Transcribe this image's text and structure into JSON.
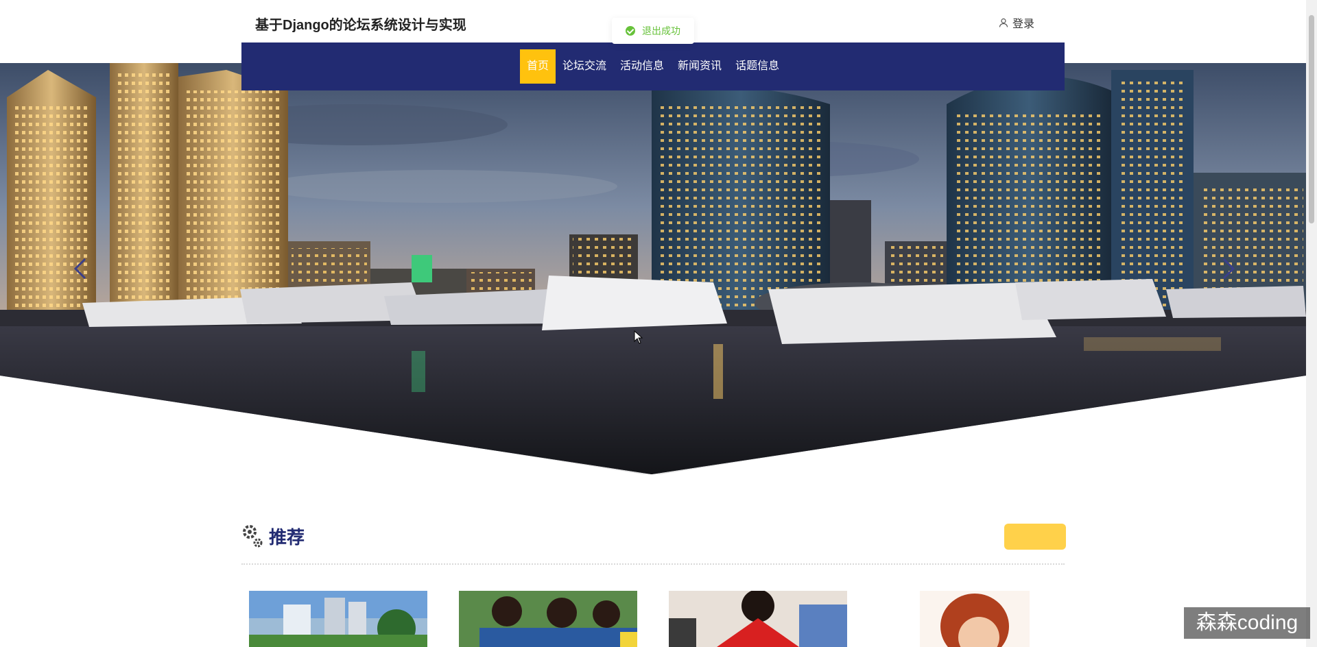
{
  "header": {
    "title": "基于Django的论坛系统设计与实现",
    "login_label": "登录"
  },
  "toast": {
    "message": "退出成功"
  },
  "nav": {
    "items": [
      {
        "label": "首页",
        "active": true
      },
      {
        "label": "论坛交流",
        "active": false
      },
      {
        "label": "活动信息",
        "active": false
      },
      {
        "label": "新闻资讯",
        "active": false
      },
      {
        "label": "话题信息",
        "active": false
      }
    ]
  },
  "section": {
    "title": "推荐"
  },
  "watermark": {
    "text": "森森coding"
  },
  "colors": {
    "nav_bg": "#222b72",
    "accent": "#ffc20e",
    "success": "#67c23a",
    "title": "#222b72"
  },
  "icons": {
    "user": "user-icon",
    "check": "check-circle-icon",
    "gear": "gear-icon",
    "prev": "chevron-left-icon",
    "next": "chevron-right-icon"
  }
}
